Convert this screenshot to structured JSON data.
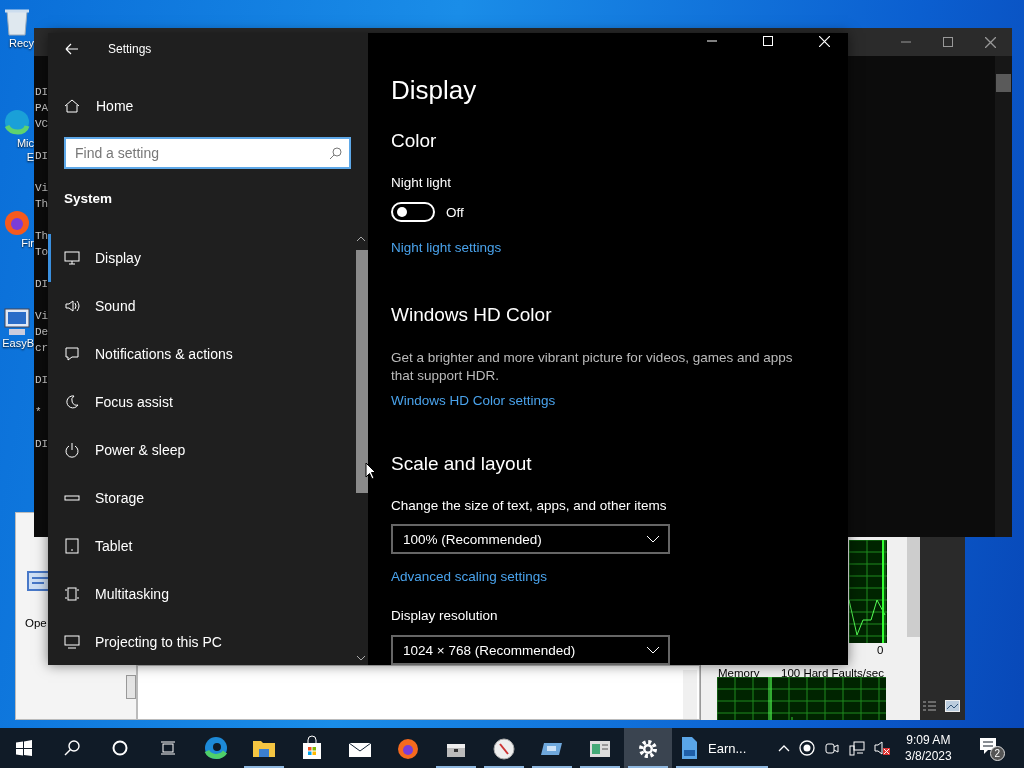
{
  "desktop_icons": [
    {
      "label_lines": [
        "Recy"
      ]
    },
    {
      "label_lines": [
        "Mic",
        "E"
      ]
    },
    {
      "label_lines": [
        "Fir"
      ]
    },
    {
      "label_lines": [
        "EasyB"
      ]
    }
  ],
  "console_window": {
    "blocks": [
      [
        "DI",
        "PA",
        "VC"
      ],
      [
        "DI"
      ],
      [
        "Vi",
        "Th"
      ],
      [
        "Th",
        "To"
      ],
      [
        "DI"
      ],
      [
        "Vi",
        "De",
        "cr"
      ],
      [
        "DI"
      ],
      [
        "*"
      ],
      [
        "DI"
      ]
    ]
  },
  "background_window": {
    "label": "Ope"
  },
  "performance_monitor": {
    "axis_value": "0",
    "counter_label": "Memory",
    "counter_scale": "100 Hard Faults/sec"
  },
  "settings": {
    "title": "Settings",
    "home": "Home",
    "search": {
      "placeholder": "Find a setting"
    },
    "section": "System",
    "nav_items": [
      {
        "label": "Display",
        "selected": true
      },
      {
        "label": "Sound",
        "selected": false
      },
      {
        "label": "Notifications & actions",
        "selected": false
      },
      {
        "label": "Focus assist",
        "selected": false
      },
      {
        "label": "Power & sleep",
        "selected": false
      },
      {
        "label": "Storage",
        "selected": false
      },
      {
        "label": "Tablet",
        "selected": false
      },
      {
        "label": "Multitasking",
        "selected": false
      },
      {
        "label": "Projecting to this PC",
        "selected": false
      }
    ],
    "page_title": "Display",
    "color_heading": "Color",
    "night_light": {
      "label": "Night light",
      "on": false,
      "state_text": "Off"
    },
    "night_light_link": "Night light settings",
    "hd_heading": "Windows HD Color",
    "hd_description": "Get a brighter and more vibrant picture for videos, games and apps that support HDR.",
    "hd_link": "Windows HD Color settings",
    "scale_heading": "Scale and layout",
    "scale_label": "Change the size of text, apps, and other items",
    "scale_value": "100% (Recommended)",
    "scale_link": "Advanced scaling settings",
    "resolution_label": "Display resolution",
    "resolution_value": "1024 × 768 (Recommended)"
  },
  "taskbar": {
    "apps": [
      {
        "running": true,
        "selected": false
      },
      {
        "running": false,
        "selected": false
      },
      {
        "running": false,
        "selected": false
      },
      {
        "running": false,
        "selected": false
      },
      {
        "running": true,
        "selected": false
      },
      {
        "running": true,
        "selected": false
      },
      {
        "running": true,
        "selected": false
      },
      {
        "running": true,
        "selected": false
      },
      {
        "running": true,
        "selected": true
      }
    ],
    "open_file": {
      "label": "Earn...",
      "running": true,
      "selected": false
    },
    "time": "9:09 AM",
    "date": "3/8/2023",
    "notification_count": "2",
    "volume_muted": true
  }
}
